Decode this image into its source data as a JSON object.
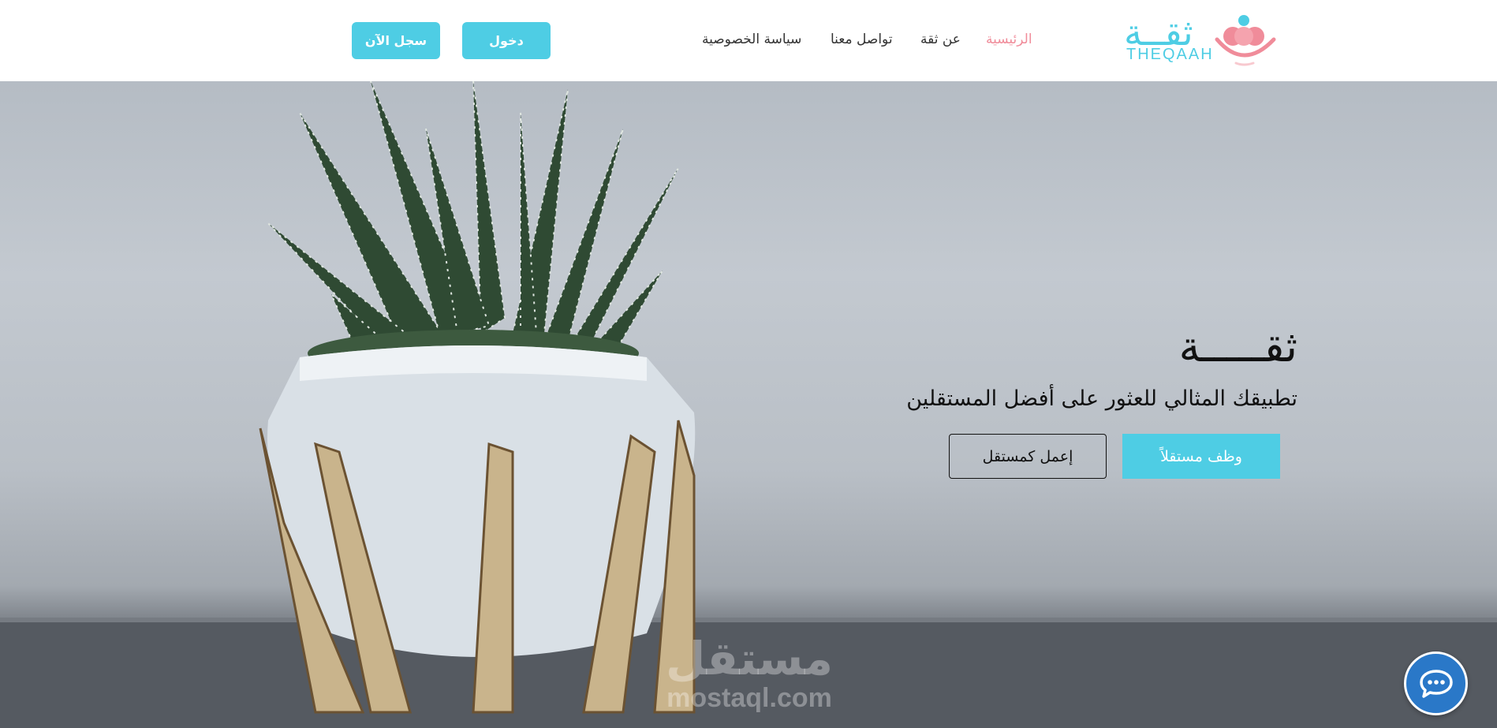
{
  "brand": {
    "name_ar": "ثقــة",
    "name_en": "THEQAAH",
    "colors": {
      "primary": "#4ecde4",
      "accent": "#f08c9a"
    }
  },
  "nav": {
    "items": [
      {
        "label": "الرئيسية",
        "active": true
      },
      {
        "label": "عن ثقة",
        "active": false
      },
      {
        "label": "تواصل معنا",
        "active": false
      },
      {
        "label": "سياسة الخصوصية",
        "active": false
      }
    ],
    "login_label": "دخول",
    "register_label": "سجل الآن"
  },
  "hero": {
    "title": "ثقـــــة",
    "subtitle": "تطبيقك المثالي للعثور على أفضل المستقلين",
    "hire_label": "وظف مستقلاً",
    "work_label": "إعمل كمستقل"
  },
  "watermark": {
    "text_ar": "مستقل",
    "text_en": "mostaql.com"
  },
  "chat": {
    "icon": "chat-bubble-icon"
  }
}
